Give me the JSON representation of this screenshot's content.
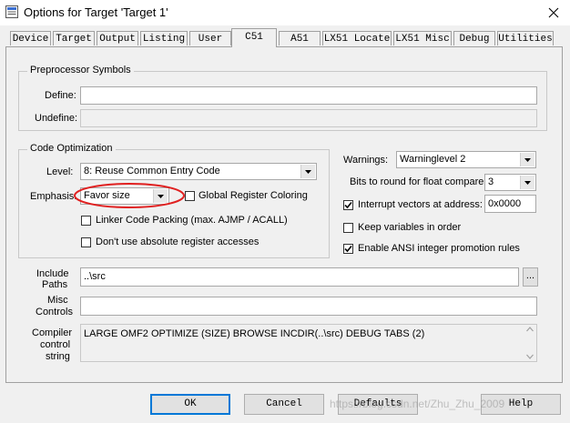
{
  "window": {
    "title": "Options for Target 'Target 1'",
    "icon": "keil-project-icon",
    "close_icon": "close-icon"
  },
  "tabs": [
    {
      "label": "Device"
    },
    {
      "label": "Target"
    },
    {
      "label": "Output"
    },
    {
      "label": "Listing"
    },
    {
      "label": "User"
    },
    {
      "label": "C51",
      "active": true
    },
    {
      "label": "A51"
    },
    {
      "label": "LX51 Locate"
    },
    {
      "label": "LX51 Misc"
    },
    {
      "label": "Debug"
    },
    {
      "label": "Utilities"
    }
  ],
  "preprocessor": {
    "title": "Preprocessor Symbols",
    "define_label": "Define:",
    "define_value": "",
    "undefine_label": "Undefine:",
    "undefine_value": ""
  },
  "code_opt": {
    "title": "Code Optimization",
    "level_label": "Level:",
    "level_value": "8: Reuse Common Entry Code",
    "emphasis_label": "Emphasis:",
    "emphasis_value": "Favor size",
    "global_reg_label": "Global Register Coloring",
    "global_reg_checked": false,
    "linker_pack_label": "Linker Code Packing (max. AJMP / ACALL)",
    "linker_pack_checked": false,
    "no_abs_label": "Don't use absolute register accesses",
    "no_abs_checked": false
  },
  "right": {
    "warnings_label": "Warnings:",
    "warnings_value": "Warninglevel 2",
    "bits_label": "Bits to round for float compare:",
    "bits_value": "3",
    "interrupt_label": "Interrupt vectors at address:",
    "interrupt_checked": true,
    "interrupt_value": "0x0000",
    "keep_vars_label": "Keep variables in order",
    "keep_vars_checked": false,
    "ansi_label": "Enable ANSI integer promotion rules",
    "ansi_checked": true
  },
  "paths": {
    "include_label_1": "Include",
    "include_label_2": "Paths",
    "include_value": "..\\src",
    "browse_label": "...",
    "misc_label_1": "Misc",
    "misc_label_2": "Controls",
    "misc_value": "",
    "compiler_label_1": "Compiler",
    "compiler_label_2": "control",
    "compiler_label_3": "string",
    "compiler_value": "LARGE OMF2 OPTIMIZE (SIZE) BROWSE INCDIR(..\\src) DEBUG TABS (2)"
  },
  "buttons": {
    "ok": "OK",
    "cancel": "Cancel",
    "defaults": "Defaults",
    "help": "Help"
  },
  "annotation": {
    "color": "#e02020"
  },
  "watermark": "https://blog.csdn.net/Zhu_Zhu_2009"
}
